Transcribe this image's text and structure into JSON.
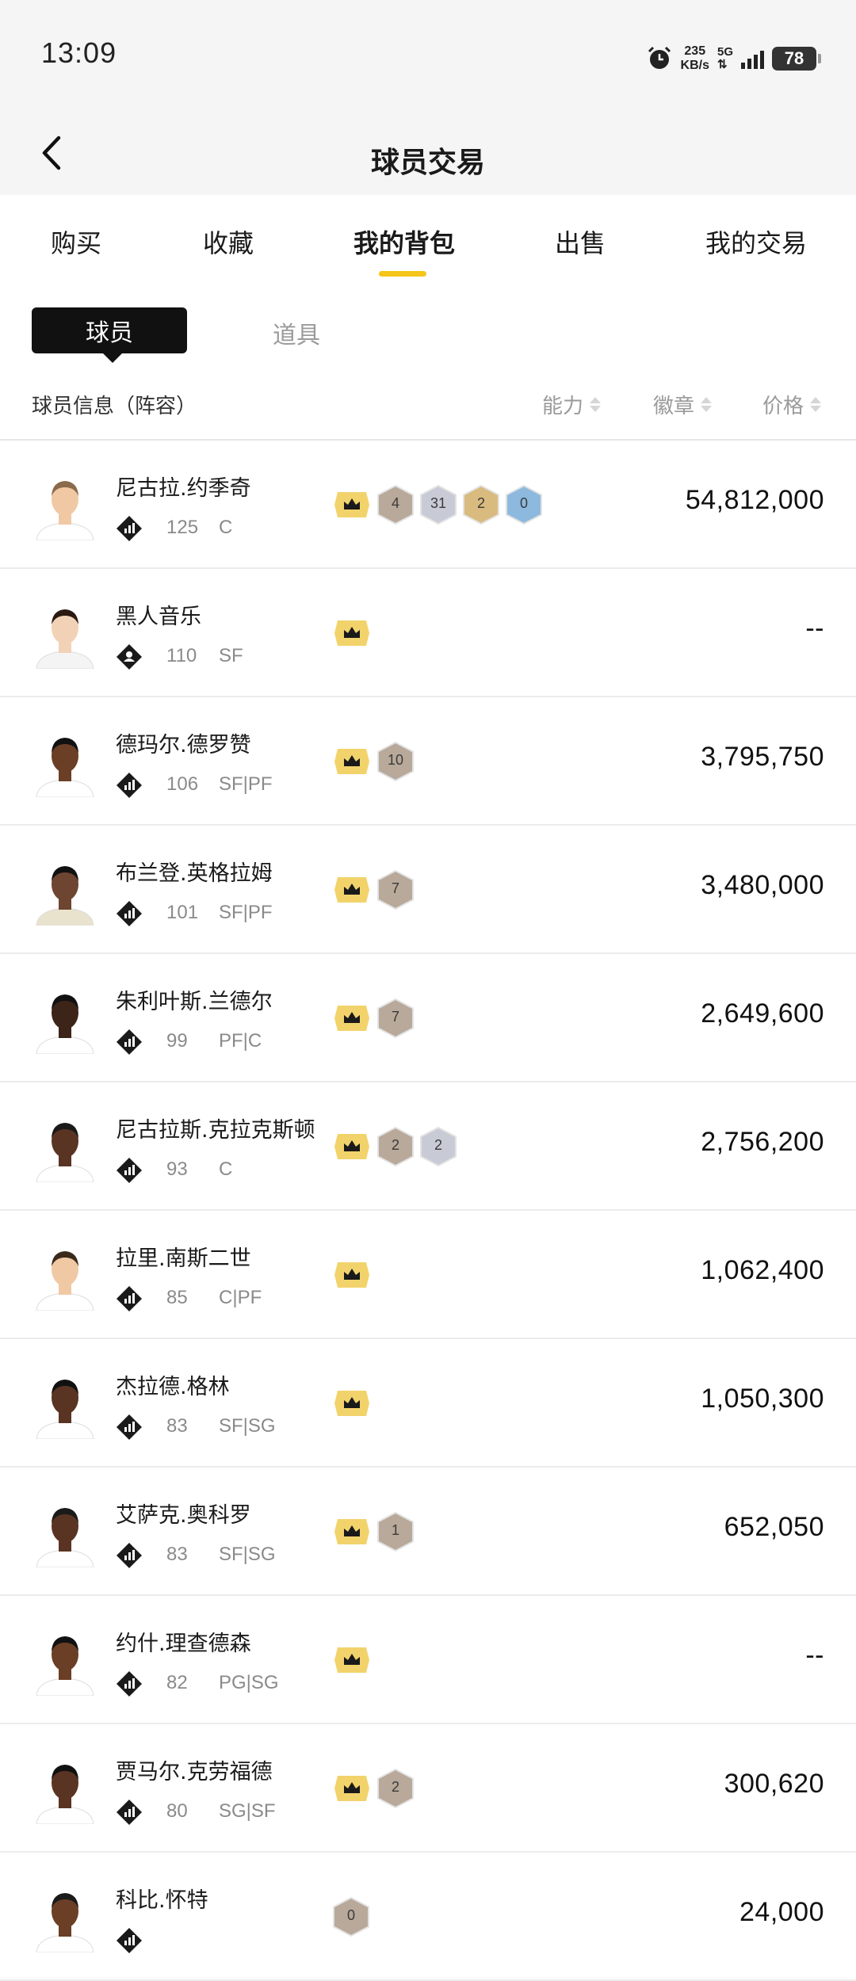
{
  "status_bar": {
    "time": "13:09",
    "speed_value": "235",
    "speed_unit": "KB/s",
    "network": "5G",
    "battery": "78"
  },
  "nav": {
    "title": "球员交易"
  },
  "tabs": [
    {
      "label": "购买"
    },
    {
      "label": "收藏"
    },
    {
      "label": "我的背包"
    },
    {
      "label": "出售"
    },
    {
      "label": "我的交易"
    }
  ],
  "subtabs": {
    "players": "球员",
    "items": "道具"
  },
  "list_header": {
    "info": "球员信息（阵容）",
    "ability": "能力",
    "badges": "徽章",
    "price": "价格"
  },
  "colors": {
    "accent": "#f5c518",
    "crown_bg": "#f2d36b",
    "badge_bronze": "#b8a99a",
    "badge_silver": "#c8cbd6",
    "badge_gold": "#d9bb7f",
    "badge_blue": "#8db9de"
  },
  "players": [
    {
      "name": "尼古拉.约季奇",
      "ability": "125",
      "positions": "C",
      "tier_icon": "stats-icon",
      "badges": [
        {
          "type": "bronze",
          "value": "4"
        },
        {
          "type": "silver",
          "value": "31"
        },
        {
          "type": "gold",
          "value": "2"
        },
        {
          "type": "blue",
          "value": "0"
        }
      ],
      "price": "54,812,000"
    },
    {
      "name": "黑人音乐",
      "ability": "110",
      "positions": "SF",
      "tier_icon": "person-icon",
      "badges": [],
      "price": "--"
    },
    {
      "name": "德玛尔.德罗赞",
      "ability": "106",
      "positions": "SF|PF",
      "tier_icon": "stats-icon",
      "badges": [
        {
          "type": "bronze",
          "value": "10"
        }
      ],
      "price": "3,795,750"
    },
    {
      "name": "布兰登.英格拉姆",
      "ability": "101",
      "positions": "SF|PF",
      "tier_icon": "stats-icon",
      "badges": [
        {
          "type": "bronze",
          "value": "7"
        }
      ],
      "price": "3,480,000"
    },
    {
      "name": "朱利叶斯.兰德尔",
      "ability": "99",
      "positions": "PF|C",
      "tier_icon": "stats-icon",
      "badges": [
        {
          "type": "bronze",
          "value": "7"
        }
      ],
      "price": "2,649,600"
    },
    {
      "name": "尼古拉斯.克拉克斯顿",
      "ability": "93",
      "positions": "C",
      "tier_icon": "stats-icon",
      "badges": [
        {
          "type": "bronze",
          "value": "2"
        },
        {
          "type": "silver",
          "value": "2"
        }
      ],
      "price": "2,756,200"
    },
    {
      "name": "拉里.南斯二世",
      "ability": "85",
      "positions": "C|PF",
      "tier_icon": "stats-icon",
      "badges": [],
      "price": "1,062,400"
    },
    {
      "name": "杰拉德.格林",
      "ability": "83",
      "positions": "SF|SG",
      "tier_icon": "stats-icon",
      "badges": [],
      "price": "1,050,300"
    },
    {
      "name": "艾萨克.奥科罗",
      "ability": "83",
      "positions": "SF|SG",
      "tier_icon": "stats-icon",
      "badges": [
        {
          "type": "bronze",
          "value": "1"
        }
      ],
      "price": "652,050"
    },
    {
      "name": "约什.理查德森",
      "ability": "82",
      "positions": "PG|SG",
      "tier_icon": "stats-icon",
      "badges": [],
      "price": "--"
    },
    {
      "name": "贾马尔.克劳福德",
      "ability": "80",
      "positions": "SG|SF",
      "tier_icon": "stats-icon",
      "badges": [
        {
          "type": "bronze",
          "value": "2"
        }
      ],
      "price": "300,620"
    },
    {
      "name": "科比.怀特",
      "ability": "",
      "positions": "",
      "tier_icon": "stats-icon",
      "badges": [
        {
          "type": "bronze",
          "value": "0"
        }
      ],
      "price": "24,000"
    }
  ]
}
